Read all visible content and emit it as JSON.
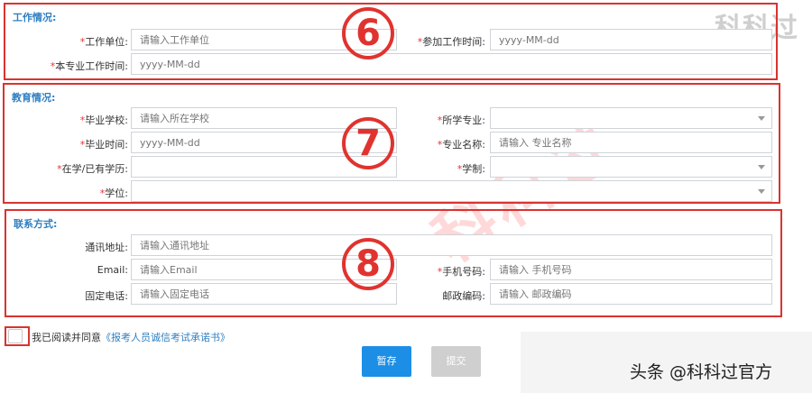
{
  "watermark": {
    "top_text": "科科过",
    "diagonal_text": "科科过"
  },
  "sections": {
    "work": {
      "title": "工作情况:",
      "badge": "6",
      "work_unit": {
        "label": "工作单位:",
        "placeholder": "请输入工作单位"
      },
      "start_work_time": {
        "label": "参加工作时间:",
        "placeholder": "yyyy-MM-dd"
      },
      "major_work_time": {
        "label": "本专业工作时间:",
        "placeholder": "yyyy-MM-dd"
      }
    },
    "education": {
      "title": "教育情况:",
      "badge": "7",
      "school": {
        "label": "毕业学校:",
        "placeholder": "请输入所在学校"
      },
      "major": {
        "label": "所学专业:",
        "value": ""
      },
      "graduation_time": {
        "label": "毕业时间:",
        "placeholder": "yyyy-MM-dd"
      },
      "major_name": {
        "label": "专业名称:",
        "placeholder": "请输入 专业名称"
      },
      "degree_level": {
        "label": "在学/已有学历:",
        "value": ""
      },
      "study_system": {
        "label": "学制:",
        "value": ""
      },
      "academic_degree": {
        "label": "学位:",
        "value": ""
      }
    },
    "contact": {
      "title": "联系方式:",
      "badge": "8",
      "address": {
        "label": "通讯地址:",
        "placeholder": "请输入通讯地址"
      },
      "email": {
        "label": "Email:",
        "placeholder": "请输入Email"
      },
      "mobile": {
        "label": "手机号码:",
        "placeholder": "请输入 手机号码"
      },
      "phone": {
        "label": "固定电话:",
        "placeholder": "请输入固定电话"
      },
      "postcode": {
        "label": "邮政编码:",
        "placeholder": "请输入 邮政编码"
      }
    }
  },
  "agreement": {
    "text": "我已阅读并同意",
    "link": "《报考人员诚信考试承诺书》",
    "checked": false
  },
  "buttons": {
    "save": "暂存",
    "submit": "提交"
  },
  "footer": {
    "text": "头条 @科科过官方"
  },
  "colors": {
    "section_border": "#d9332f",
    "title_blue": "#2f7fc1",
    "primary_button": "#1c8ee6",
    "disabled_button": "#cfcfcf",
    "required_star": "#e0332f"
  }
}
